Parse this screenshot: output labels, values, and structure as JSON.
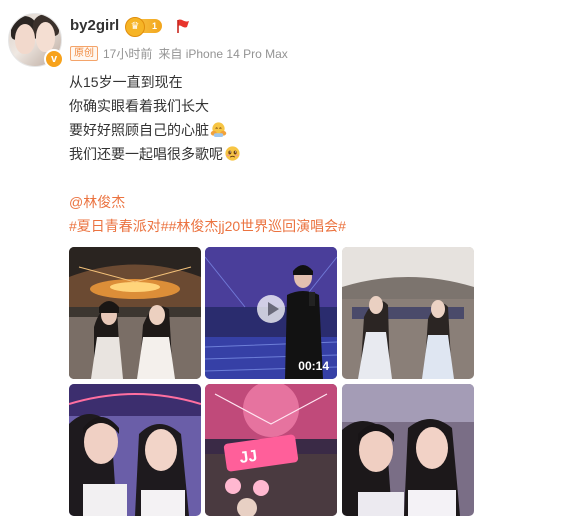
{
  "post": {
    "username": "by2girl",
    "level": "1",
    "verified_mark": "v",
    "source_tag": "原创",
    "time": "17小时前",
    "source": "来自 iPhone 14 Pro Max",
    "lines": [
      "从15岁一直到现在",
      "你确实眼看着我们长大",
      "要好好照顾自己的心脏",
      "我们还要一起唱很多歌呢"
    ],
    "mention": "@林俊杰",
    "topics": "#夏日青春派对##林俊杰jj20世界巡回演唱会#",
    "video_duration": "00:14",
    "icons": {
      "avatar": "avatar",
      "level_badge": "crown-icon",
      "flag": "red-flag-icon",
      "line3_emoji": "hug-emoji-icon",
      "line4_emoji": "moved-face-emoji-icon",
      "play": "play-icon"
    },
    "colors": {
      "link": "#eb7340",
      "text": "#333333",
      "meta": "#939393",
      "badge": "#f7a21b"
    }
  }
}
